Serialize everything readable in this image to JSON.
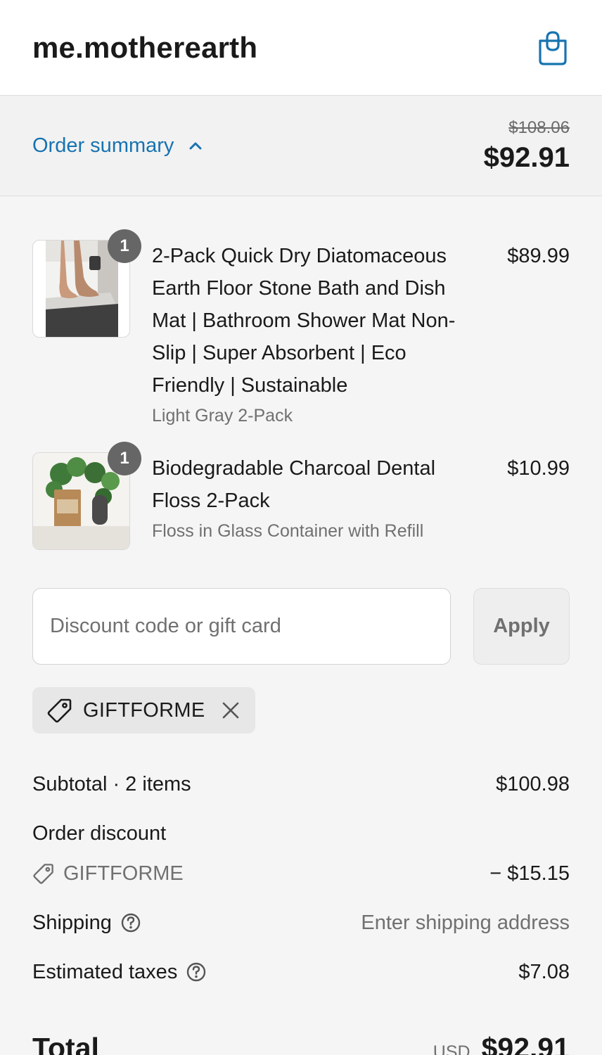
{
  "header": {
    "store_name": "me.motherearth",
    "bag_icon": "shopping-bag-icon"
  },
  "summary_bar": {
    "toggle_label": "Order summary",
    "chevron_icon": "chevron-up-icon",
    "original_price": "$108.06",
    "total_price": "$92.91"
  },
  "items": [
    {
      "quantity": "1",
      "title": "2-Pack Quick Dry Diatomaceous Earth Floor Stone Bath and Dish Mat | Bathroom Shower Mat Non-Slip | Super Absorbent | Eco Friendly | Sustainable",
      "variant": "Light Gray 2-Pack",
      "price": "$89.99"
    },
    {
      "quantity": "1",
      "title": "Biodegradable Charcoal Dental Floss 2-Pack",
      "variant": "Floss in Glass Container with Refill",
      "price": "$10.99"
    }
  ],
  "discount": {
    "placeholder": "Discount code or gift card",
    "value": "",
    "apply_label": "Apply",
    "applied_code": "GIFTFORME"
  },
  "totals": {
    "subtotal_label": "Subtotal · 2 items",
    "subtotal_value": "$100.98",
    "order_discount_label": "Order discount",
    "discount_code": "GIFTFORME",
    "discount_value": "− $15.15",
    "shipping_label": "Shipping",
    "shipping_value": "Enter shipping address",
    "taxes_label": "Estimated taxes",
    "taxes_value": "$7.08",
    "total_label": "Total",
    "currency": "USD",
    "total_value": "$92.91"
  },
  "colors": {
    "accent": "#1773b0",
    "badge": "#666666",
    "muted_text": "#707070"
  }
}
